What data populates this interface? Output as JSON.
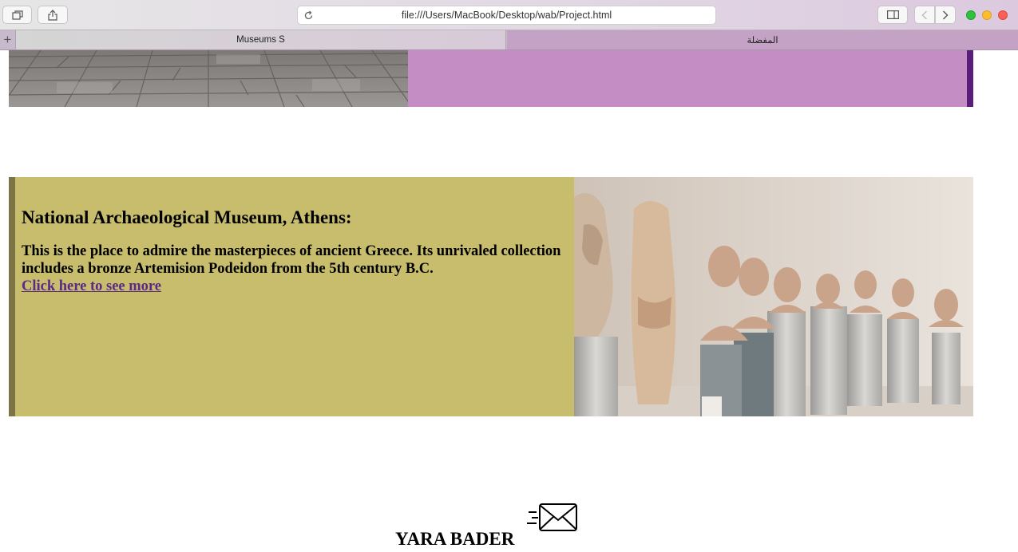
{
  "browser": {
    "url": "file:///Users/MacBook/Desktop/wab/Project.html",
    "tabs": [
      {
        "label": "Museums S",
        "active": true
      },
      {
        "label": "المفضلة",
        "active": false
      }
    ],
    "new_tab_symbol": "+"
  },
  "colors": {
    "purple_panel": "#c48dc3",
    "purple_border": "#5b1d7a",
    "museum_card": "#c7bd6c",
    "museum_border": "#7b7444",
    "link": "#5a2a86"
  },
  "top_card": {
    "image_icon": "stone-pavement-photo"
  },
  "museum": {
    "title": "National Archaeological Museum, Athens:",
    "description": "This is the place to admire the masterpieces of ancient Greece. Its unrivaled collection includes a bronze Artemision Podeidon from the 5th century B.C.",
    "link_text": "Click here to see more",
    "image_icon": "marble-busts-photo"
  },
  "footer": {
    "name": "YARA BADER",
    "icon": "mail-icon"
  }
}
